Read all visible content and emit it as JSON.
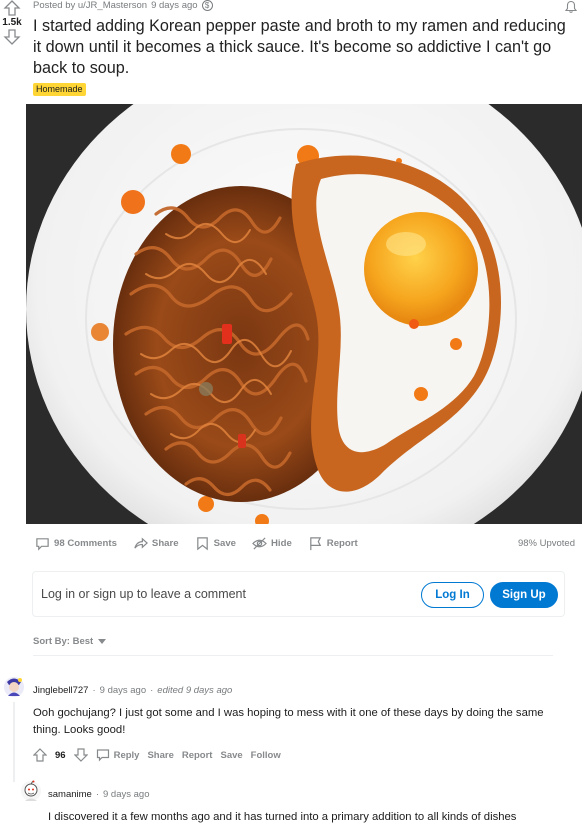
{
  "post": {
    "score": "1.5k",
    "posted_by": "Posted by u/JR_Masterson",
    "age": "9 days ago",
    "coin_glyph": "$",
    "title": "I started adding Korean pepper paste and broth to my ramen and reducing it down until it becomes a thick sauce. It's become so addictive I can't go back to soup.",
    "flair": "Homemade",
    "flair_color": "#ffd635"
  },
  "actions": {
    "comments": "98 Comments",
    "share": "Share",
    "save": "Save",
    "hide": "Hide",
    "report": "Report",
    "upvoted": "98% Upvoted"
  },
  "login_prompt": {
    "text": "Log in or sign up to leave a comment",
    "login": "Log In",
    "signup": "Sign Up",
    "accent": "#0079d3"
  },
  "sort": {
    "label": "Sort By: Best"
  },
  "comments": [
    {
      "author": "Jinglebell727",
      "age": "9 days ago",
      "edited": "edited 9 days ago",
      "body": "Ooh gochujang? I just got some and I was hoping to mess with it one of these days by doing the same thing. Looks good!",
      "score": "96",
      "reply": "Reply",
      "share": "Share",
      "report": "Report",
      "save": "Save",
      "follow": "Follow"
    },
    {
      "author": "samanime",
      "age": "9 days ago",
      "body": "I discovered it a few months ago and it has turned into a primary addition to all kinds of dishes"
    }
  ]
}
